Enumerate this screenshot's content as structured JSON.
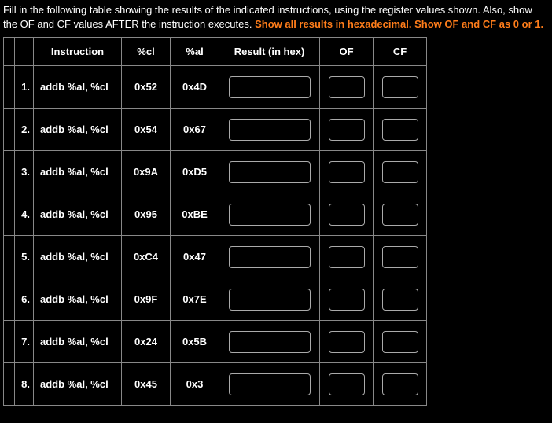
{
  "prompt": {
    "part1": "Fill in the following table showing the results of the indicated instructions, using the register values shown. Also, show the OF and CF values AFTER the instruction executes. ",
    "highlight": "Show all results in hexadecimal. Show OF and CF as 0 or 1."
  },
  "headers": {
    "instruction": "Instruction",
    "cl": "%cl",
    "al": "%al",
    "result": "Result (in hex)",
    "of": "OF",
    "cf": "CF"
  },
  "rows": [
    {
      "num": "1.",
      "instruction": "addb %al, %cl",
      "cl": "0x52",
      "al": "0x4D",
      "result": "",
      "of": "",
      "cf": ""
    },
    {
      "num": "2.",
      "instruction": "addb %al, %cl",
      "cl": "0x54",
      "al": "0x67",
      "result": "",
      "of": "",
      "cf": ""
    },
    {
      "num": "3.",
      "instruction": "addb %al, %cl",
      "cl": "0x9A",
      "al": "0xD5",
      "result": "",
      "of": "",
      "cf": ""
    },
    {
      "num": "4.",
      "instruction": "addb %al, %cl",
      "cl": "0x95",
      "al": "0xBE",
      "result": "",
      "of": "",
      "cf": ""
    },
    {
      "num": "5.",
      "instruction": "addb %al, %cl",
      "cl": "0xC4",
      "al": "0x47",
      "result": "",
      "of": "",
      "cf": ""
    },
    {
      "num": "6.",
      "instruction": "addb %al, %cl",
      "cl": "0x9F",
      "al": "0x7E",
      "result": "",
      "of": "",
      "cf": ""
    },
    {
      "num": "7.",
      "instruction": "addb %al, %cl",
      "cl": "0x24",
      "al": "0x5B",
      "result": "",
      "of": "",
      "cf": ""
    },
    {
      "num": "8.",
      "instruction": "addb %al, %cl",
      "cl": "0x45",
      "al": "0x3",
      "result": "",
      "of": "",
      "cf": ""
    }
  ]
}
